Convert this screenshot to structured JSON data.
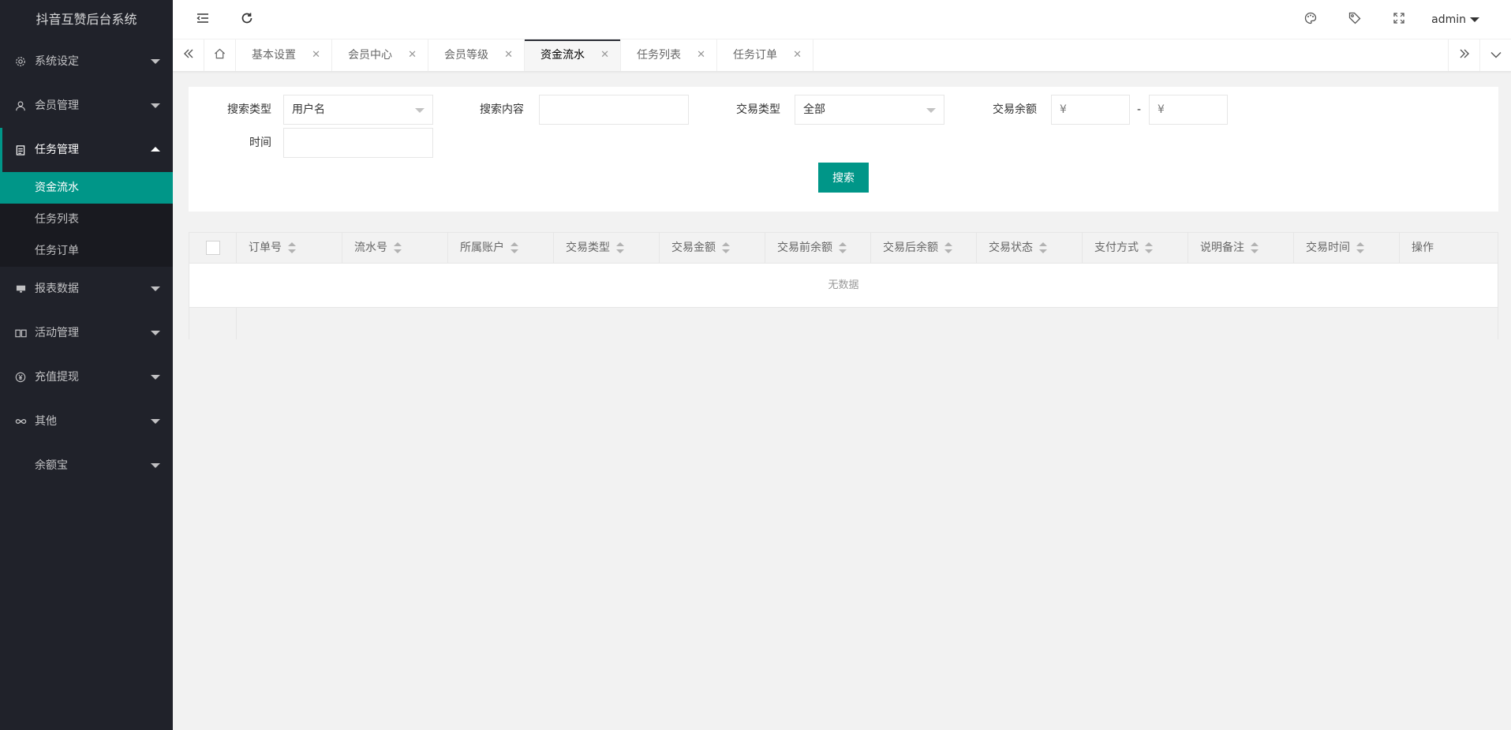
{
  "app": {
    "title": "抖音互赞后台系统"
  },
  "sidebar": {
    "items": [
      {
        "label": "系统设定",
        "icon": "gear-icon"
      },
      {
        "label": "会员管理",
        "icon": "user-icon"
      },
      {
        "label": "任务管理",
        "icon": "document-icon",
        "open": true,
        "children": [
          {
            "label": "资金流水",
            "active": true
          },
          {
            "label": "任务列表"
          },
          {
            "label": "任务订单"
          }
        ]
      },
      {
        "label": "报表数据",
        "icon": "monitor-icon"
      },
      {
        "label": "活动管理",
        "icon": "book-icon"
      },
      {
        "label": "充值提现",
        "icon": "yen-icon"
      },
      {
        "label": "其他",
        "icon": "infinity-icon"
      },
      {
        "label": "余额宝",
        "icon": ""
      }
    ]
  },
  "header": {
    "user": "admin"
  },
  "tabs": {
    "items": [
      {
        "label": "基本设置"
      },
      {
        "label": "会员中心"
      },
      {
        "label": "会员等级"
      },
      {
        "label": "资金流水",
        "active": true
      },
      {
        "label": "任务列表"
      },
      {
        "label": "任务订单"
      }
    ]
  },
  "search": {
    "type_label": "搜索类型",
    "type_value": "用户名",
    "content_label": "搜索内容",
    "content_value": "",
    "trade_type_label": "交易类型",
    "trade_type_value": "全部",
    "balance_label": "交易余额",
    "balance_min_placeholder": "¥",
    "balance_max_placeholder": "¥",
    "range_dash": "-",
    "time_label": "时间",
    "time_value": "",
    "button": "搜索"
  },
  "table": {
    "columns": [
      "订单号",
      "流水号",
      "所属账户",
      "交易类型",
      "交易金额",
      "交易前余额",
      "交易后余额",
      "交易状态",
      "支付方式",
      "说明备注",
      "交易时间",
      "操作"
    ],
    "empty_text": "无数据"
  },
  "colors": {
    "accent": "#009688",
    "sidebar_bg": "#20222a",
    "submenu_bg": "#191a20"
  }
}
